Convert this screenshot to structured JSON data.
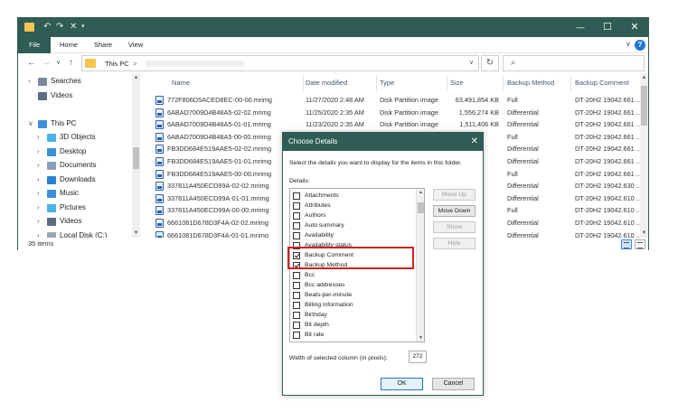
{
  "titlebar": {
    "quick_access": [
      "↶",
      "↷",
      "✕",
      "▾"
    ],
    "minimize": "—",
    "maximize": "☐",
    "close": "✕",
    "color": "#2f5c54"
  },
  "ribbon": {
    "file": "File",
    "tabs": [
      "Home",
      "Share",
      "View"
    ],
    "collapse": "∨",
    "help": "?"
  },
  "address": {
    "back": "←",
    "forward": "→",
    "recent": "∨",
    "up": "↑",
    "crumb": "This PC",
    "separator": ">",
    "dropdown": "∨",
    "refresh": "↻",
    "search_icon": "⌕"
  },
  "nav_pane": {
    "items": [
      {
        "chev": "›",
        "label": "Searches",
        "icon": "search-folder-icon",
        "color": "#7a8aa0"
      },
      {
        "chev": "",
        "label": "Videos",
        "icon": "videos-folder-icon",
        "color": "#5b6b80"
      },
      {
        "chev": "",
        "label": "",
        "icon": "",
        "color": ""
      },
      {
        "chev": "∨",
        "label": "This PC",
        "icon": "computer-icon",
        "color": "#3c8fd8"
      },
      {
        "chev": "›",
        "label": "3D Objects",
        "icon": "3d-objects-icon",
        "color": "#4ab3e6"
      },
      {
        "chev": "›",
        "label": "Desktop",
        "icon": "desktop-icon",
        "color": "#3c8fd8"
      },
      {
        "chev": "›",
        "label": "Documents",
        "icon": "documents-icon",
        "color": "#8aa0b8"
      },
      {
        "chev": "›",
        "label": "Downloads",
        "icon": "downloads-icon",
        "color": "#2a7fd4"
      },
      {
        "chev": "›",
        "label": "Music",
        "icon": "music-icon",
        "color": "#3c8fd8"
      },
      {
        "chev": "›",
        "label": "Pictures",
        "icon": "pictures-icon",
        "color": "#4ab3e6"
      },
      {
        "chev": "›",
        "label": "Videos",
        "icon": "videos-icon",
        "color": "#5b6b80"
      },
      {
        "chev": "›",
        "label": "Local Disk (C:)",
        "icon": "drive-icon",
        "color": "#9aa5b1"
      }
    ],
    "up_arrow": "▲",
    "down_arrow": "▼"
  },
  "file_list": {
    "columns": [
      "Name",
      "Date modified",
      "Type",
      "Size",
      "Backup Method",
      "Backup Comment"
    ],
    "sort_indicator": "^",
    "rows": [
      {
        "name": "772F806D5ACED8EC-00-00.mrimg",
        "date": "11/27/2020 2:48 AM",
        "type": "Disk Partition image",
        "size": "63,491,854 KB",
        "method": "Full",
        "comment": "DT-20H2 19042.661 ..."
      },
      {
        "name": "6ABAD7009D4B48A5-02-02.mrimg",
        "date": "11/25/2020 2:35 AM",
        "type": "Disk Partition image",
        "size": "1,556,274 KB",
        "method": "Differential",
        "comment": "DT-20H2 19042.661 ..."
      },
      {
        "name": "6ABAD7009D4B48A5-01-01.mrimg",
        "date": "11/23/2020 2:35 AM",
        "type": "Disk Partition image",
        "size": "1,511,406 KB",
        "method": "Differential",
        "comment": "DT-20H2 19042.661 ..."
      },
      {
        "name": "6ABAD7009D4B48A5-00-00.mrimg",
        "date": "",
        "type": "",
        "size": "",
        "method": "Full",
        "comment": "DT-20H2 19042.661 ..."
      },
      {
        "name": "FB3DD684E519AAE5-02-02.mrimg",
        "date": "",
        "type": "",
        "size": "",
        "method": "Differential",
        "comment": "DT-20H2 19042.661 ..."
      },
      {
        "name": "FB3DD684E519AAE5-01-01.mrimg",
        "date": "",
        "type": "",
        "size": "",
        "method": "Differential",
        "comment": "DT-20H2 19042.661 ..."
      },
      {
        "name": "FB3DD684E519AAE5-00-00.mrimg",
        "date": "",
        "type": "",
        "size": "",
        "method": "Full",
        "comment": "DT-20H2 19042.661 ..."
      },
      {
        "name": "337811A450ECD99A-02-02.mrimg",
        "date": "",
        "type": "",
        "size": "",
        "method": "Differential",
        "comment": "DT-20H2 19042.630 ..."
      },
      {
        "name": "337811A450ECD99A-01-01.mrimg",
        "date": "",
        "type": "",
        "size": "",
        "method": "Differential",
        "comment": "DT-20H2 19042.610 ..."
      },
      {
        "name": "337811A450ECD99A-00-00.mrimg",
        "date": "",
        "type": "",
        "size": "",
        "method": "Full",
        "comment": "DT-20H2 19042.610 ..."
      },
      {
        "name": "6661081D678D3F4A-02-02.mrimg",
        "date": "",
        "type": "",
        "size": "",
        "method": "Differential",
        "comment": "DT-20H2 19042.610 ..."
      },
      {
        "name": "6661081D678D3F4A-01-01.mrimg",
        "date": "",
        "type": "",
        "size": "",
        "method": "Differential",
        "comment": "DT-20H2 19042.610 ..."
      }
    ],
    "up_arrow": "▲",
    "down_arrow": "▼"
  },
  "status": {
    "count": "35 items"
  },
  "dialog": {
    "title": "Choose Details",
    "close": "✕",
    "instructions": "Select the details you want to display for the items in this folder.",
    "details_label": "Details:",
    "items": [
      {
        "label": "Attachments",
        "checked": false
      },
      {
        "label": "Attributes",
        "checked": false
      },
      {
        "label": "Authors",
        "checked": false
      },
      {
        "label": "Auto summary",
        "checked": false
      },
      {
        "label": "Availability",
        "checked": false
      },
      {
        "label": "Availability status",
        "checked": false
      },
      {
        "label": "Backup Comment",
        "checked": true
      },
      {
        "label": "Backup Method",
        "checked": true
      },
      {
        "label": "Bcc",
        "checked": false
      },
      {
        "label": "Bcc addresses",
        "checked": false
      },
      {
        "label": "Beats-per-minute",
        "checked": false
      },
      {
        "label": "Billing information",
        "checked": false
      },
      {
        "label": "Birthday",
        "checked": false
      },
      {
        "label": "Bit depth",
        "checked": false
      },
      {
        "label": "Bit rate",
        "checked": false
      }
    ],
    "buttons": {
      "move_up": "Move Up",
      "move_down": "Move Down",
      "show": "Show",
      "hide": "Hide"
    },
    "width_label": "Width of selected column (in pixels):",
    "width_value": "272",
    "ok": "OK",
    "cancel": "Cancel",
    "up_arrow": "▲",
    "down_arrow": "▼",
    "highlight_color": "#cc2222"
  }
}
